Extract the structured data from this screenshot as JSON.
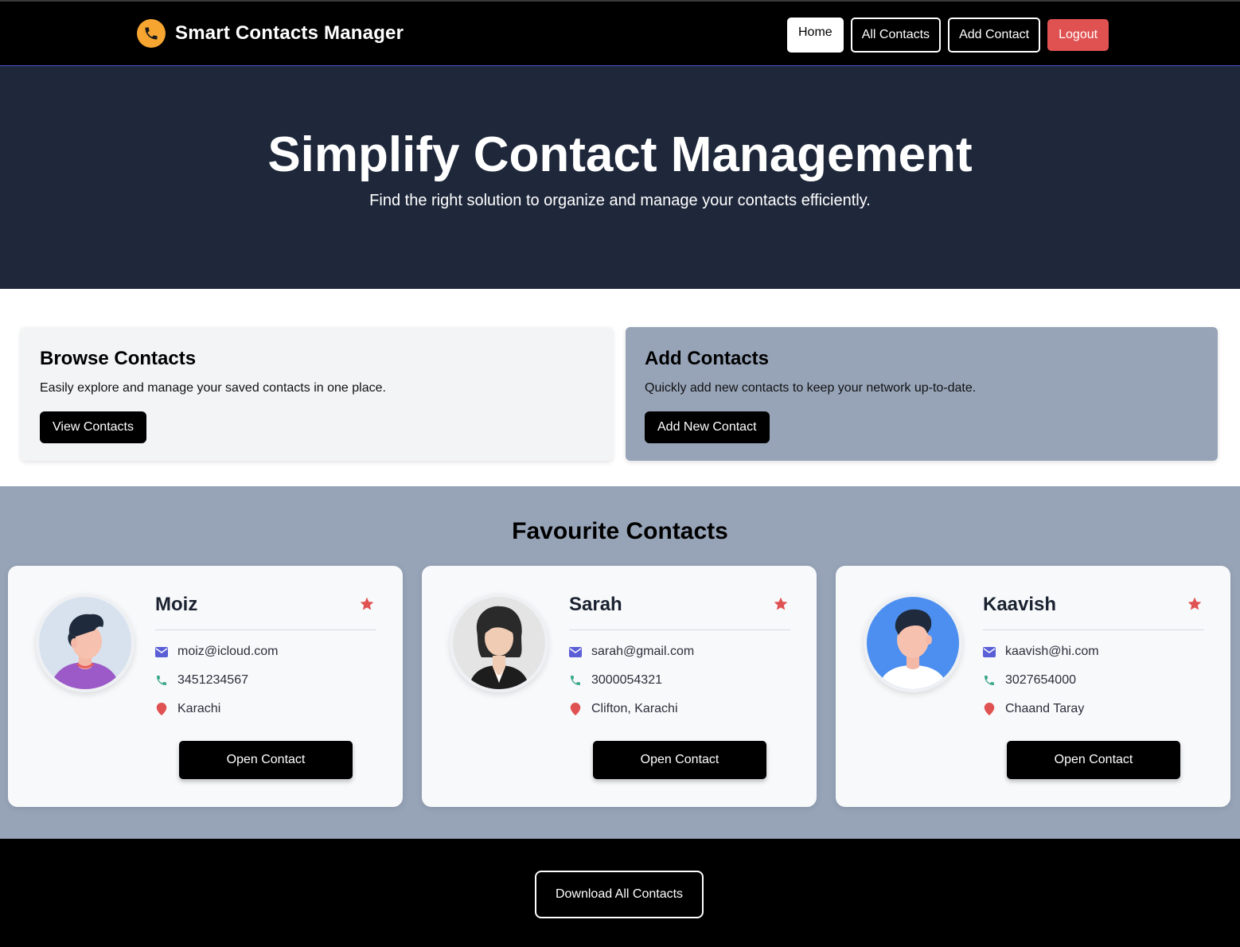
{
  "navbar": {
    "brand_title": "Smart Contacts Manager",
    "brand_icon": "phone-icon",
    "links": [
      {
        "label": "Home"
      },
      {
        "label": "All Contacts"
      },
      {
        "label": "Add Contact"
      },
      {
        "label": "Logout"
      }
    ]
  },
  "hero": {
    "title": "Simplify Contact Management",
    "subtitle": "Find the right solution to organize and manage your contacts efficiently."
  },
  "browse": {
    "title": "Browse Contacts",
    "description": "Easily explore and manage your saved contacts in one place.",
    "button": "View Contacts"
  },
  "add": {
    "title": "Add Contacts",
    "description": "Quickly add new contacts to keep your network up-to-date.",
    "button": "Add New Contact"
  },
  "favourites": {
    "title": "Favourite Contacts",
    "contacts": [
      {
        "name": "Moiz",
        "email": "moiz@icloud.com",
        "phone": "3451234567",
        "location": "Karachi",
        "button": "Open Contact"
      },
      {
        "name": "Sarah",
        "email": "sarah@gmail.com",
        "phone": "3000054321",
        "location": "Clifton, Karachi",
        "button": "Open Contact"
      },
      {
        "name": "Kaavish",
        "email": "kaavish@hi.com",
        "phone": "3027654000",
        "location": "Chaand Taray",
        "button": "Open Contact"
      }
    ]
  },
  "footer": {
    "download_button": "Download All Contacts"
  },
  "colors": {
    "navbar_bg": "#000000",
    "hero_bg": "#1f283b",
    "accent_logout": "#e05252",
    "favourites_bg": "#97a4b8",
    "star": "#e05252",
    "email_icon": "#5b5fd6",
    "phone_icon": "#3aa88a",
    "location_icon": "#e05252"
  }
}
